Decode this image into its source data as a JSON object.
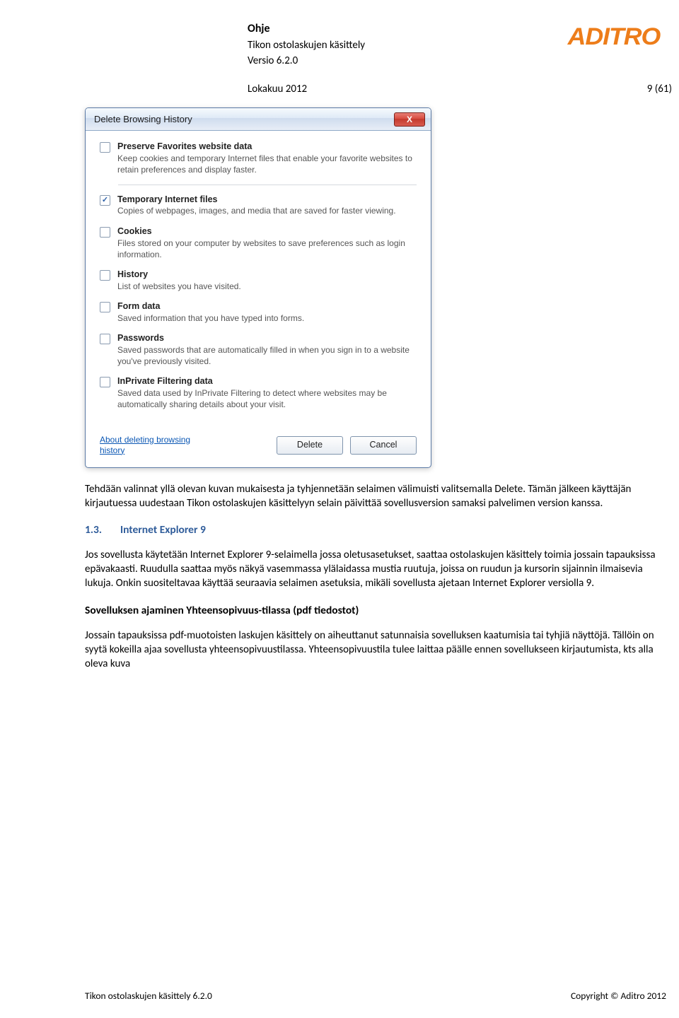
{
  "header": {
    "title": "Ohje",
    "subtitle": "Tikon ostolaskujen käsittely",
    "version": "Versio 6.2.0",
    "logo": "ADITRO"
  },
  "meta": {
    "date": "Lokakuu 2012",
    "page": "9 (61)"
  },
  "dialog": {
    "title": "Delete Browsing History",
    "close_glyph": "X",
    "options": [
      {
        "checked": false,
        "label": "Preserve Favorites website data",
        "desc": "Keep cookies and temporary Internet files that enable your favorite websites to retain preferences and display faster."
      },
      {
        "checked": true,
        "label": "Temporary Internet files",
        "desc": "Copies of webpages, images, and media that are saved for faster viewing."
      },
      {
        "checked": false,
        "label": "Cookies",
        "desc": "Files stored on your computer by websites to save preferences such as login information."
      },
      {
        "checked": false,
        "label": "History",
        "desc": "List of websites you have visited."
      },
      {
        "checked": false,
        "label": "Form data",
        "desc": "Saved information that you have typed into forms."
      },
      {
        "checked": false,
        "label": "Passwords",
        "desc": "Saved passwords that are automatically filled in when you sign in to a website you've previously visited."
      },
      {
        "checked": false,
        "label": "InPrivate Filtering data",
        "desc": "Saved data used by InPrivate Filtering to detect where websites may be automatically sharing details about your visit."
      }
    ],
    "about_link": "About deleting browsing history",
    "delete_btn": "Delete",
    "cancel_btn": "Cancel"
  },
  "body": {
    "p1": "Tehdään valinnat yllä olevan kuvan mukaisesta ja tyhjennetään selaimen välimuisti valitsemalla Delete. Tämän jälkeen käyttäjän kirjautuessa uudestaan Tikon ostolaskujen käsittelyyn selain päivittää sovellusversion samaksi palvelimen version kanssa.",
    "section_num": "1.3.",
    "section_title": "Internet Explorer 9",
    "p2": "Jos sovellusta käytetään Internet Explorer 9-selaimella jossa oletusasetukset, saattaa ostolaskujen käsittely toimia jossain tapauksissa epävakaasti. Ruudulla saattaa myös näkyä vasemmassa ylälaidassa mustia ruutuja, joissa on ruudun ja kursorin sijainnin ilmaisevia lukuja. Onkin suositeltavaa käyttää seuraavia selaimen asetuksia, mikäli sovellusta ajetaan Internet Explorer versiolla 9.",
    "subhead": "Sovelluksen ajaminen Yhteensopivuus-tilassa (pdf tiedostot)",
    "p3": "Jossain tapauksissa pdf-muotoisten laskujen käsittely on aiheuttanut satunnaisia sovelluksen kaatumisia tai tyhjiä näyttöjä. Tällöin on syytä kokeilla ajaa sovellusta yhteensopivuustilassa. Yhteensopivuustila tulee laittaa päälle ennen sovellukseen kirjautumista, kts alla oleva kuva"
  },
  "footer": {
    "left": "Tikon ostolaskujen käsittely 6.2.0",
    "right": "Copyright © Aditro 2012"
  }
}
